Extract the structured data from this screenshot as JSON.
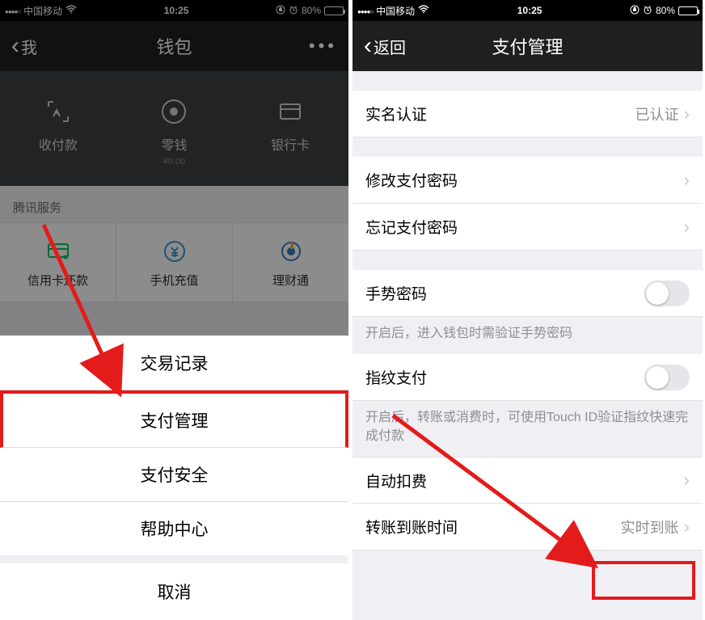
{
  "status": {
    "carrier": "中国移动",
    "time": "10:25",
    "battery": "80%"
  },
  "left": {
    "nav": {
      "back": "我",
      "title": "钱包",
      "more": "•••"
    },
    "wallet": {
      "pay": "收付款",
      "balance": "零钱",
      "balance_sub": "¥0.00",
      "card": "银行卡"
    },
    "section": "腾讯服务",
    "grid": {
      "g1": "信用卡还款",
      "g2": "手机充值",
      "g3": "理财通"
    },
    "sheet": {
      "s1": "交易记录",
      "s2": "支付管理",
      "s3": "支付安全",
      "s4": "帮助中心",
      "cancel": "取消"
    }
  },
  "right": {
    "nav": {
      "back": "返回",
      "title": "支付管理"
    },
    "cells": {
      "realname": "实名认证",
      "realname_val": "已认证",
      "change_pwd": "修改支付密码",
      "forgot_pwd": "忘记支付密码",
      "gesture": "手势密码",
      "gesture_note": "开启后，进入钱包时需验证手势密码",
      "fingerprint": "指纹支付",
      "fingerprint_note": "开启后，转账或消费时，可使用Touch ID验证指纹快速完成付款",
      "autopay": "自动扣费",
      "transfer": "转账到账时间",
      "transfer_val": "实时到账"
    }
  }
}
